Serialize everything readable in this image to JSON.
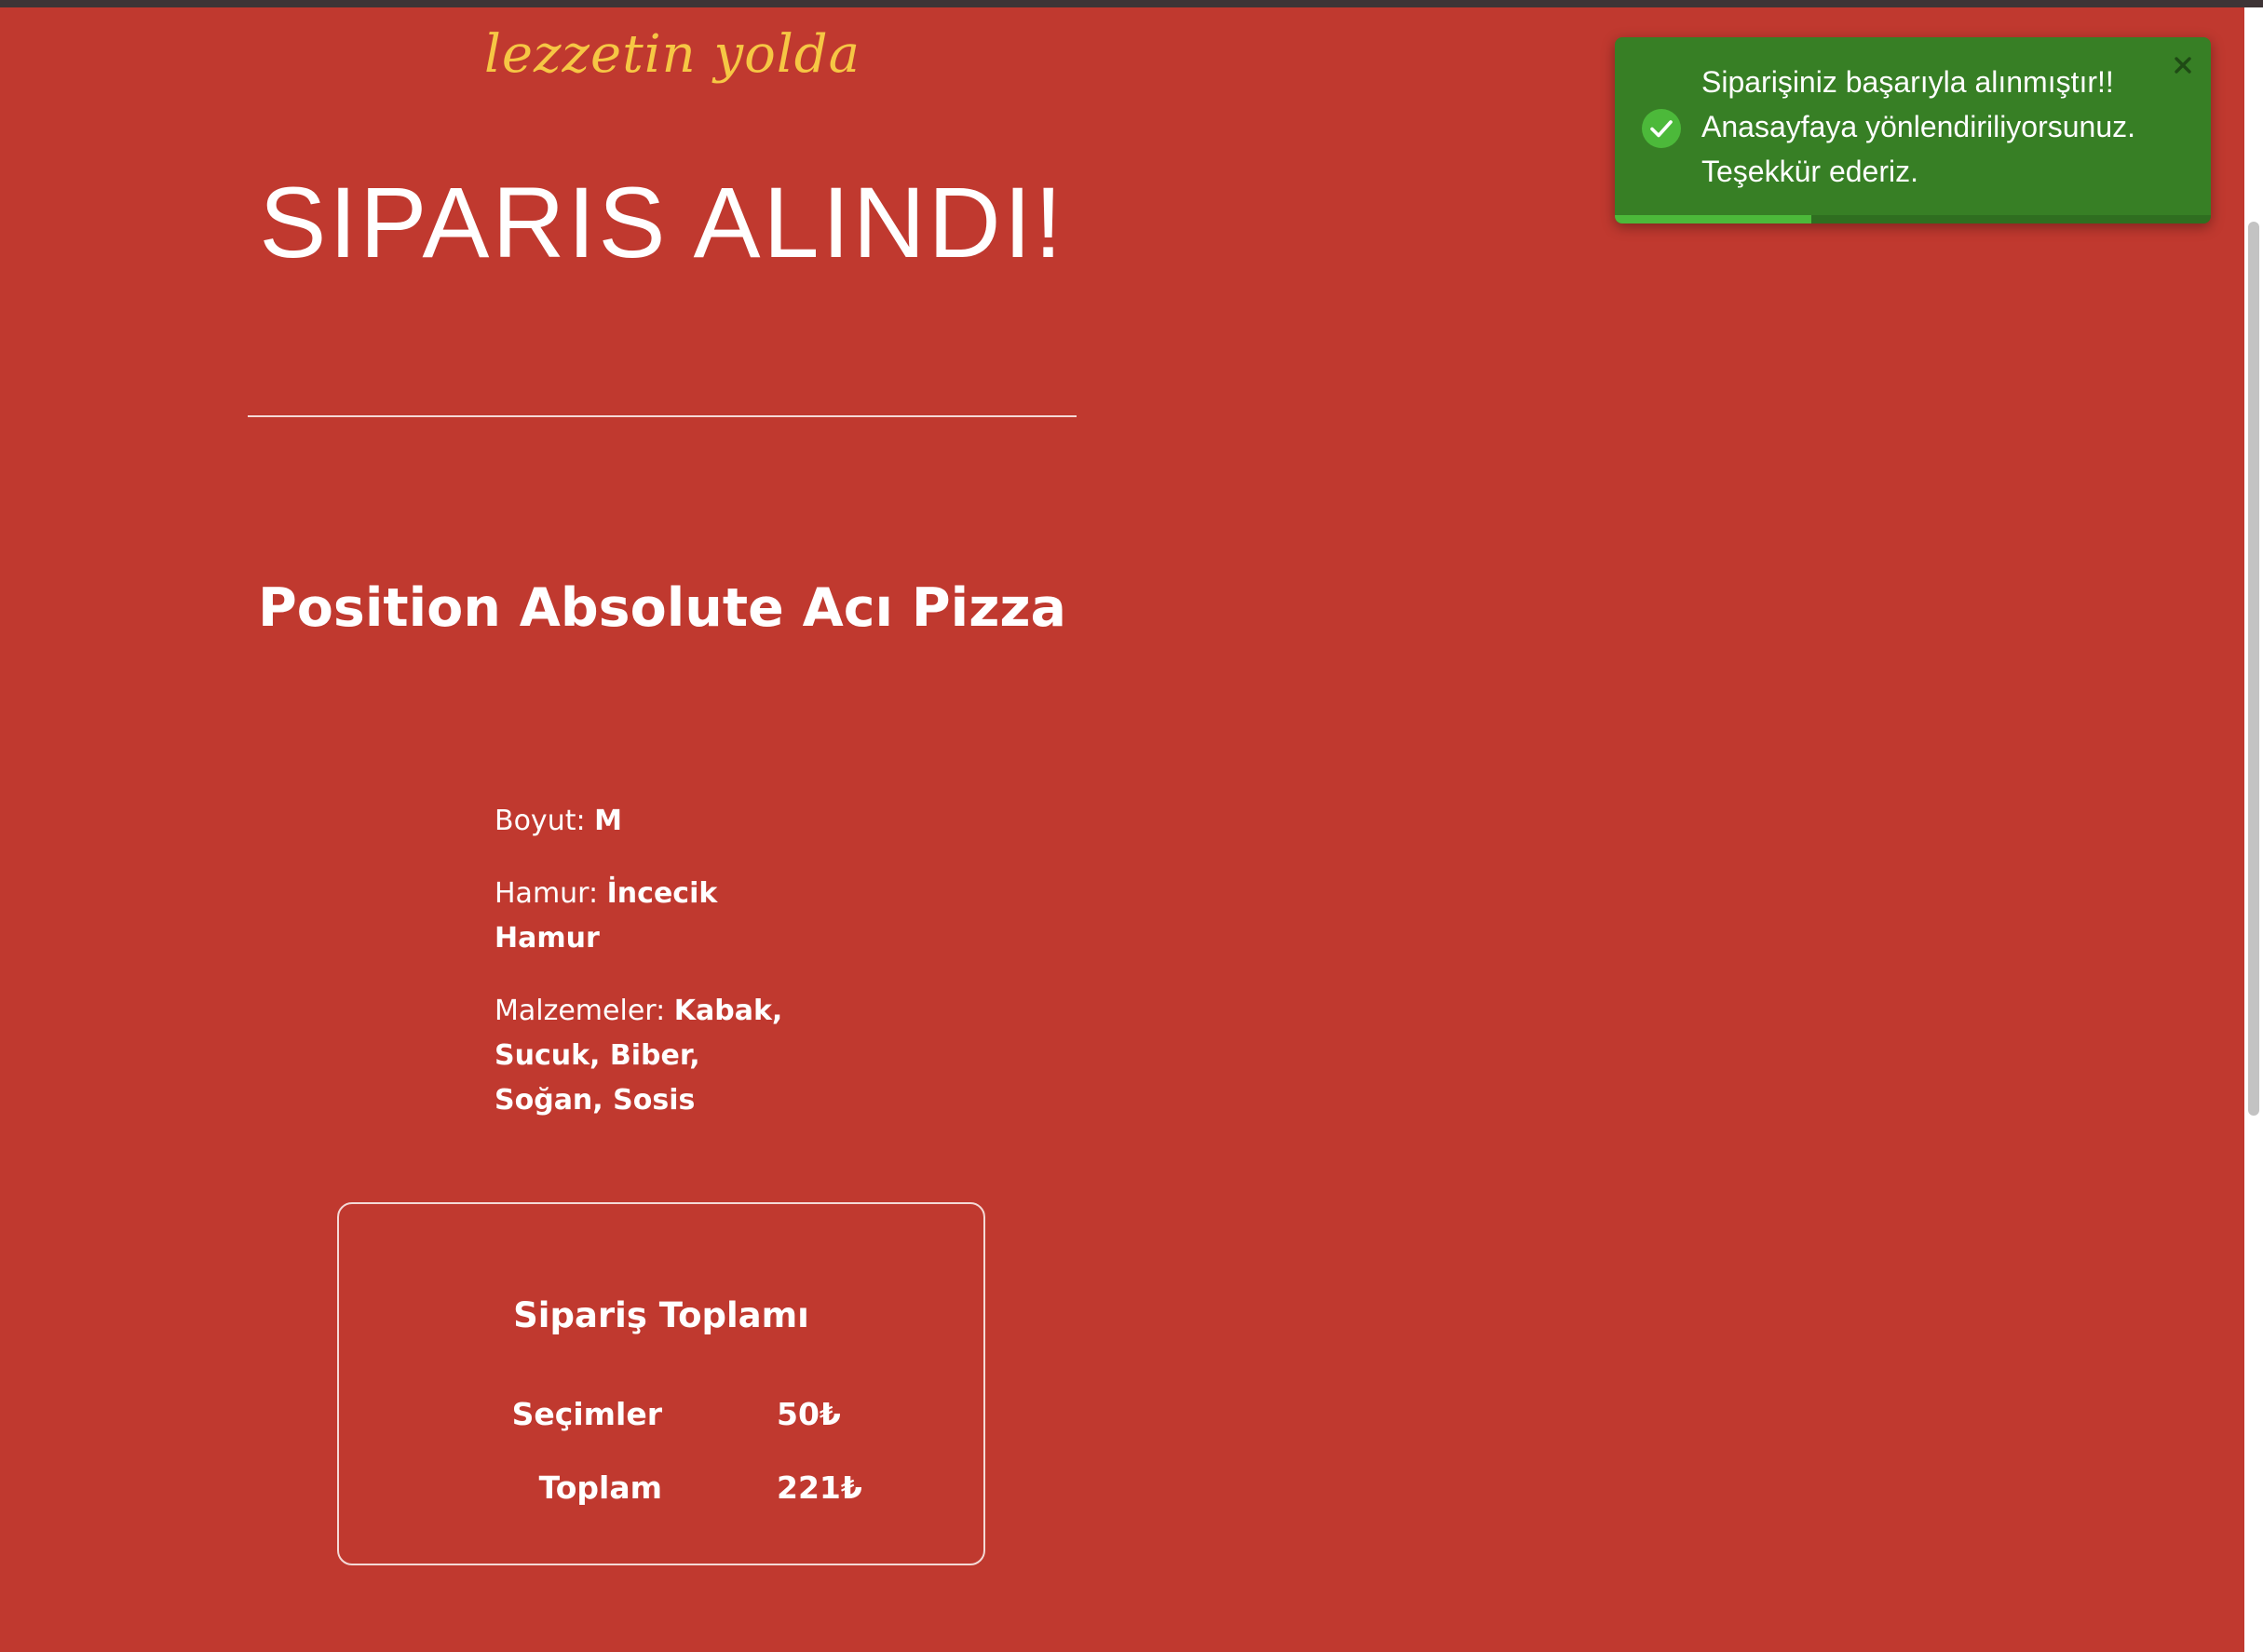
{
  "header": {
    "tagline": "lezzetin yolda"
  },
  "main": {
    "title": "SIPARIS ALINDI!",
    "pizza_name": "Position Absolute Acı Pizza",
    "details": [
      {
        "label": "Boyut: ",
        "value": "M"
      },
      {
        "label": "Hamur: ",
        "value": "İncecik Hamur"
      },
      {
        "label": "Malzemeler: ",
        "value": "Kabak, Sucuk, Biber, Soğan, Sosis"
      }
    ]
  },
  "summary": {
    "title": "Sipariş Toplamı",
    "rows": [
      {
        "label": "Seçimler",
        "value": "50₺"
      },
      {
        "label": "Toplam",
        "value": "221₺"
      }
    ]
  },
  "toast": {
    "lines": [
      "Siparişiniz başarıyla alınmıştır!!",
      "Anasayfaya yönlendiriliyorsunuz.",
      "Teşekkür ederiz."
    ],
    "icon": "check-circle-icon",
    "close_icon": "close-icon",
    "progress_fraction": 0.33,
    "colors": {
      "background": "#377f25",
      "progress": "#4cb93a",
      "icon": "#4cb93a"
    }
  },
  "colors": {
    "page_background": "#c0392f",
    "tagline": "#f6c744",
    "text": "#ffffff"
  }
}
